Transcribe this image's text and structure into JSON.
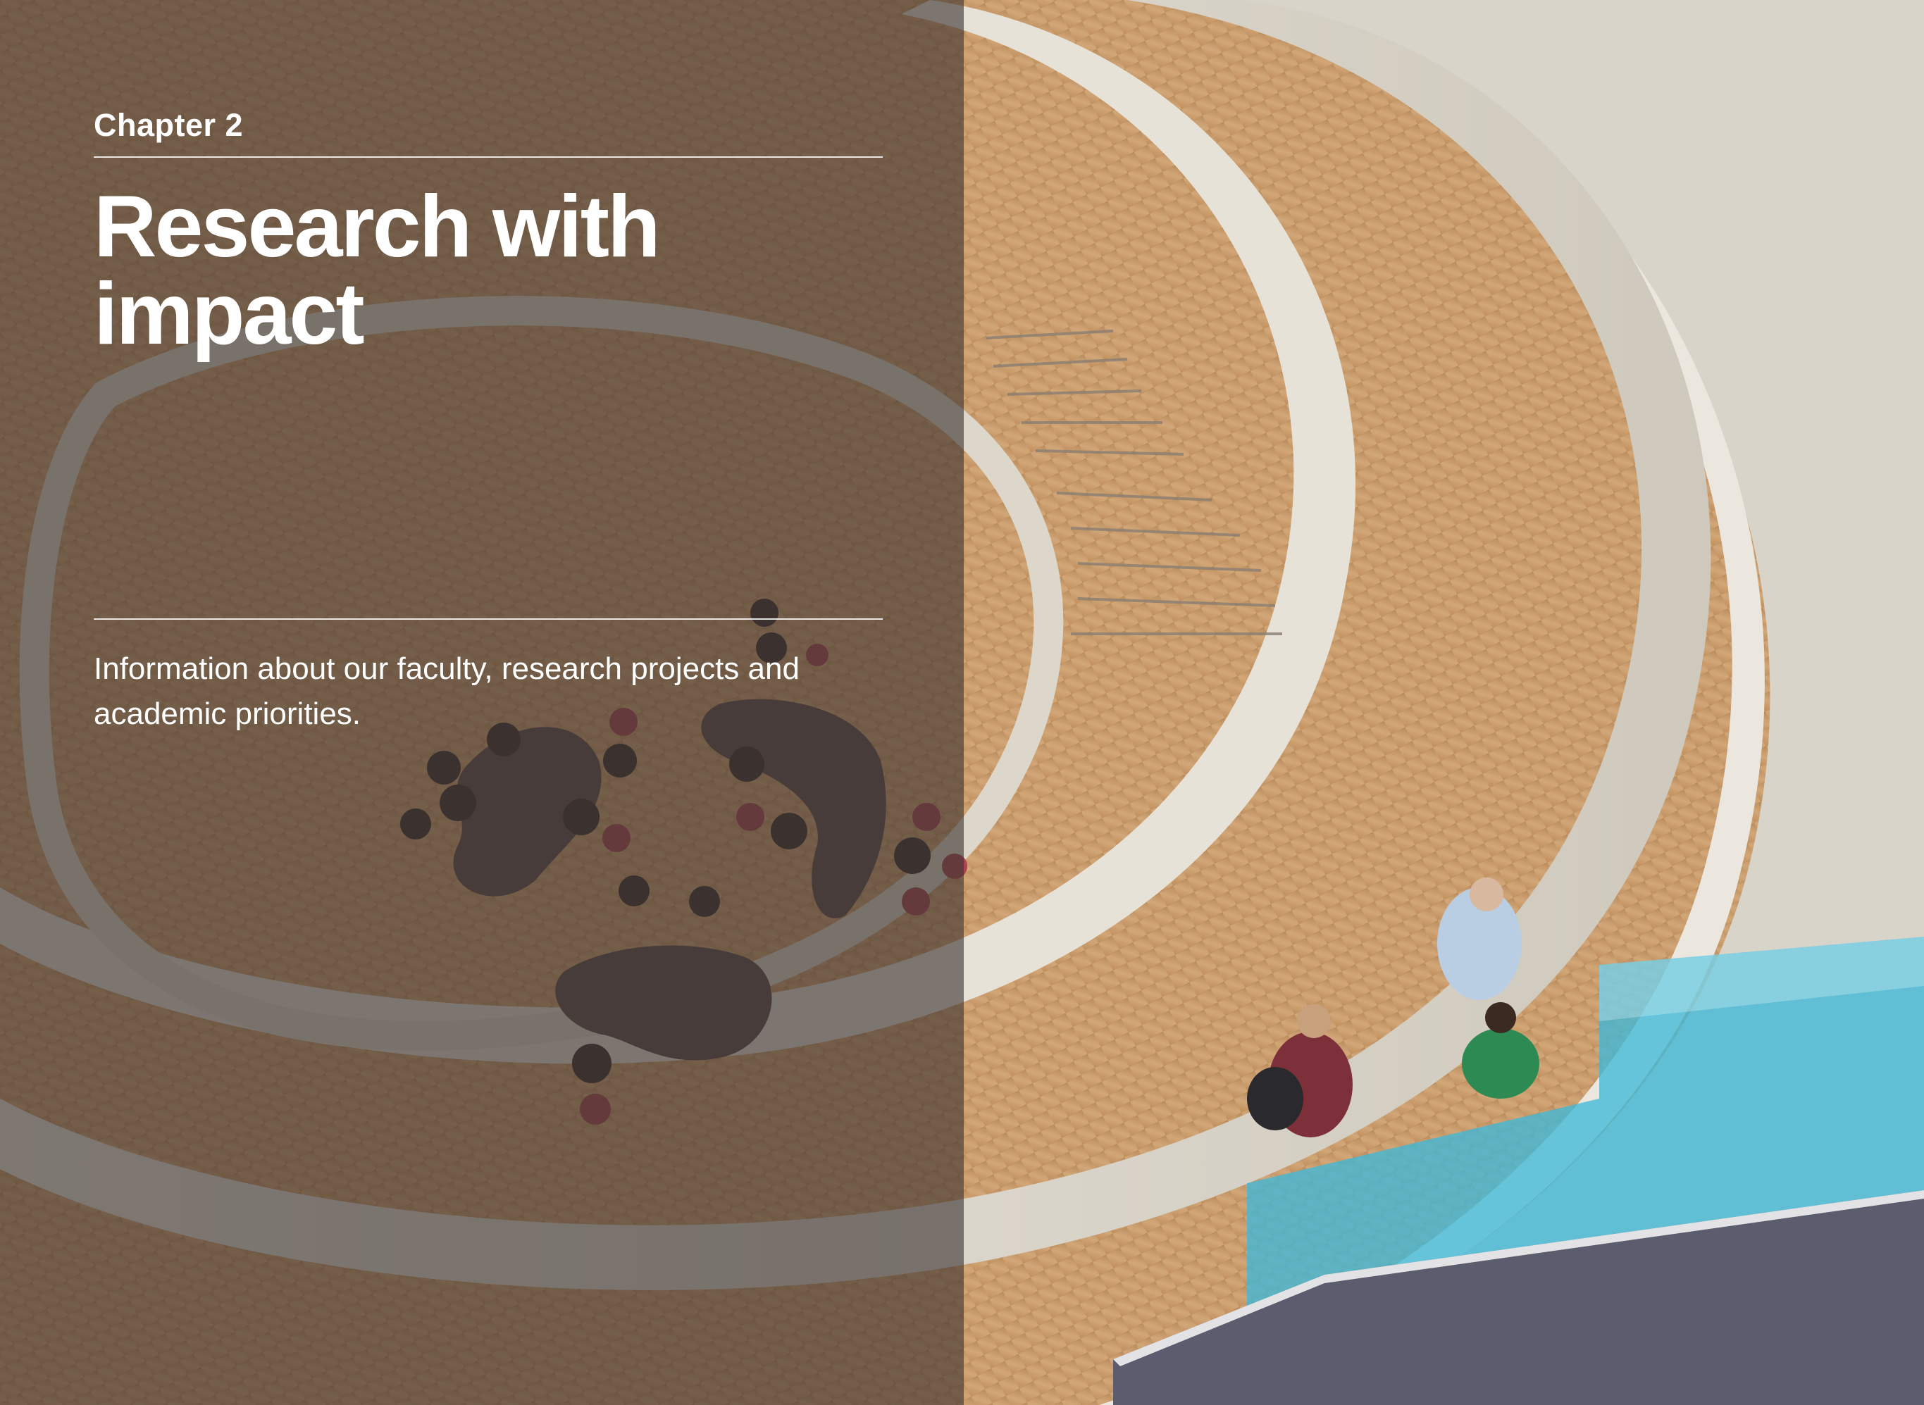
{
  "chapter": {
    "label": "Chapter 2",
    "title": "Research with impact",
    "description": "Information about our faculty, research projects and academic priorities."
  },
  "colors": {
    "overlay": "#3c3430",
    "accent_blue": "#3fb8d9",
    "accent_dark": "#5b5c6e",
    "text": "#ffffff"
  }
}
